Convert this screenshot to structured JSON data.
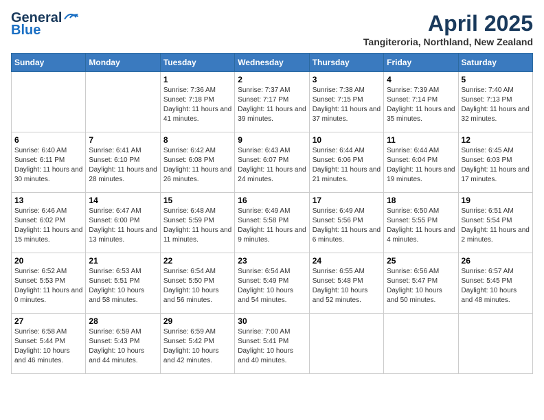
{
  "header": {
    "logo_line1": "General",
    "logo_line2": "Blue",
    "month": "April 2025",
    "location": "Tangiteroria, Northland, New Zealand"
  },
  "days_of_week": [
    "Sunday",
    "Monday",
    "Tuesday",
    "Wednesday",
    "Thursday",
    "Friday",
    "Saturday"
  ],
  "weeks": [
    [
      {
        "day": "",
        "info": ""
      },
      {
        "day": "",
        "info": ""
      },
      {
        "day": "1",
        "info": "Sunrise: 7:36 AM\nSunset: 7:18 PM\nDaylight: 11 hours and 41 minutes."
      },
      {
        "day": "2",
        "info": "Sunrise: 7:37 AM\nSunset: 7:17 PM\nDaylight: 11 hours and 39 minutes."
      },
      {
        "day": "3",
        "info": "Sunrise: 7:38 AM\nSunset: 7:15 PM\nDaylight: 11 hours and 37 minutes."
      },
      {
        "day": "4",
        "info": "Sunrise: 7:39 AM\nSunset: 7:14 PM\nDaylight: 11 hours and 35 minutes."
      },
      {
        "day": "5",
        "info": "Sunrise: 7:40 AM\nSunset: 7:13 PM\nDaylight: 11 hours and 32 minutes."
      }
    ],
    [
      {
        "day": "6",
        "info": "Sunrise: 6:40 AM\nSunset: 6:11 PM\nDaylight: 11 hours and 30 minutes."
      },
      {
        "day": "7",
        "info": "Sunrise: 6:41 AM\nSunset: 6:10 PM\nDaylight: 11 hours and 28 minutes."
      },
      {
        "day": "8",
        "info": "Sunrise: 6:42 AM\nSunset: 6:08 PM\nDaylight: 11 hours and 26 minutes."
      },
      {
        "day": "9",
        "info": "Sunrise: 6:43 AM\nSunset: 6:07 PM\nDaylight: 11 hours and 24 minutes."
      },
      {
        "day": "10",
        "info": "Sunrise: 6:44 AM\nSunset: 6:06 PM\nDaylight: 11 hours and 21 minutes."
      },
      {
        "day": "11",
        "info": "Sunrise: 6:44 AM\nSunset: 6:04 PM\nDaylight: 11 hours and 19 minutes."
      },
      {
        "day": "12",
        "info": "Sunrise: 6:45 AM\nSunset: 6:03 PM\nDaylight: 11 hours and 17 minutes."
      }
    ],
    [
      {
        "day": "13",
        "info": "Sunrise: 6:46 AM\nSunset: 6:02 PM\nDaylight: 11 hours and 15 minutes."
      },
      {
        "day": "14",
        "info": "Sunrise: 6:47 AM\nSunset: 6:00 PM\nDaylight: 11 hours and 13 minutes."
      },
      {
        "day": "15",
        "info": "Sunrise: 6:48 AM\nSunset: 5:59 PM\nDaylight: 11 hours and 11 minutes."
      },
      {
        "day": "16",
        "info": "Sunrise: 6:49 AM\nSunset: 5:58 PM\nDaylight: 11 hours and 9 minutes."
      },
      {
        "day": "17",
        "info": "Sunrise: 6:49 AM\nSunset: 5:56 PM\nDaylight: 11 hours and 6 minutes."
      },
      {
        "day": "18",
        "info": "Sunrise: 6:50 AM\nSunset: 5:55 PM\nDaylight: 11 hours and 4 minutes."
      },
      {
        "day": "19",
        "info": "Sunrise: 6:51 AM\nSunset: 5:54 PM\nDaylight: 11 hours and 2 minutes."
      }
    ],
    [
      {
        "day": "20",
        "info": "Sunrise: 6:52 AM\nSunset: 5:53 PM\nDaylight: 11 hours and 0 minutes."
      },
      {
        "day": "21",
        "info": "Sunrise: 6:53 AM\nSunset: 5:51 PM\nDaylight: 10 hours and 58 minutes."
      },
      {
        "day": "22",
        "info": "Sunrise: 6:54 AM\nSunset: 5:50 PM\nDaylight: 10 hours and 56 minutes."
      },
      {
        "day": "23",
        "info": "Sunrise: 6:54 AM\nSunset: 5:49 PM\nDaylight: 10 hours and 54 minutes."
      },
      {
        "day": "24",
        "info": "Sunrise: 6:55 AM\nSunset: 5:48 PM\nDaylight: 10 hours and 52 minutes."
      },
      {
        "day": "25",
        "info": "Sunrise: 6:56 AM\nSunset: 5:47 PM\nDaylight: 10 hours and 50 minutes."
      },
      {
        "day": "26",
        "info": "Sunrise: 6:57 AM\nSunset: 5:45 PM\nDaylight: 10 hours and 48 minutes."
      }
    ],
    [
      {
        "day": "27",
        "info": "Sunrise: 6:58 AM\nSunset: 5:44 PM\nDaylight: 10 hours and 46 minutes."
      },
      {
        "day": "28",
        "info": "Sunrise: 6:59 AM\nSunset: 5:43 PM\nDaylight: 10 hours and 44 minutes."
      },
      {
        "day": "29",
        "info": "Sunrise: 6:59 AM\nSunset: 5:42 PM\nDaylight: 10 hours and 42 minutes."
      },
      {
        "day": "30",
        "info": "Sunrise: 7:00 AM\nSunset: 5:41 PM\nDaylight: 10 hours and 40 minutes."
      },
      {
        "day": "",
        "info": ""
      },
      {
        "day": "",
        "info": ""
      },
      {
        "day": "",
        "info": ""
      }
    ]
  ]
}
